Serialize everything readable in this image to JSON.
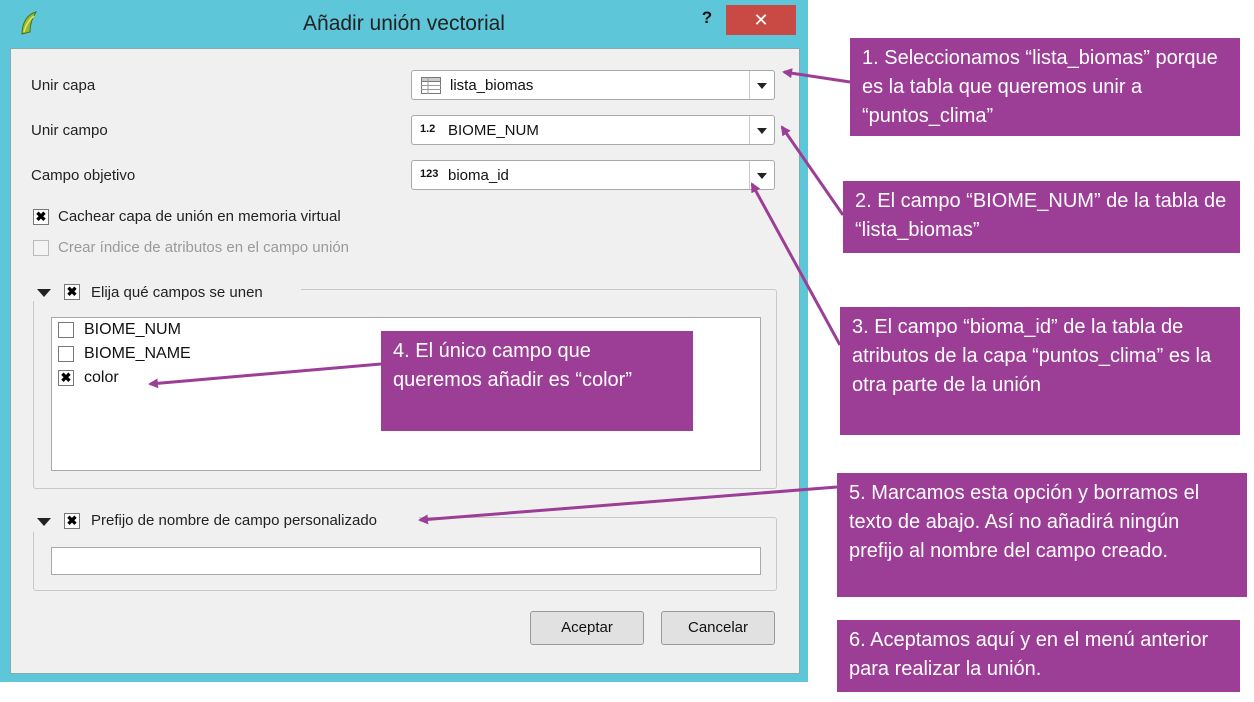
{
  "window": {
    "title": "Añadir unión vectorial",
    "help_label": "?",
    "close_label": "✕"
  },
  "form": {
    "join_layer": {
      "label": "Unir capa",
      "value": "lista_biomas",
      "icon": "table-icon"
    },
    "join_field": {
      "label": "Unir campo",
      "value": "BIOME_NUM",
      "type_badge": "1.2"
    },
    "target_field": {
      "label": "Campo objetivo",
      "value": "bioma_id",
      "type_badge": "123"
    },
    "cache": {
      "label": "Cachear capa de unión en memoria virtual",
      "checked": true,
      "mark": "✖"
    },
    "index": {
      "label": "Crear índice de atributos en el campo unión",
      "checked": false
    },
    "fields_group": {
      "label": "Elija qué campos se unen",
      "checked": true,
      "mark": "✖"
    },
    "fields": [
      {
        "name": "BIOME_NUM",
        "checked": false,
        "mark": ""
      },
      {
        "name": "BIOME_NAME",
        "checked": false,
        "mark": ""
      },
      {
        "name": "color",
        "checked": true,
        "mark": "✖"
      }
    ],
    "prefix_group": {
      "label": "Prefijo de nombre de campo personalizado",
      "checked": true,
      "mark": "✖"
    },
    "prefix_value": ""
  },
  "buttons": {
    "ok": "Aceptar",
    "cancel": "Cancelar"
  },
  "annotations": {
    "n1": "1. Seleccionamos “lista_biomas” porque es la tabla que queremos unir a “puntos_clima”",
    "n2": "2. El campo “BIOME_NUM” de la tabla de “lista_biomas”",
    "n3": "3. El campo “bioma_id” de la tabla de atributos de la capa “puntos_clima” es la otra parte de la unión",
    "n4": "4. El único campo que queremos añadir es “color”",
    "n5": "5. Marcamos esta opción y borramos el texto de abajo. Así no añadirá ningún prefijo al nombre del campo creado.",
    "n6": "6. Aceptamos aquí y en el menú anterior para realizar la unión."
  },
  "colors": {
    "titlebar": "#5ec6d9",
    "close": "#c94a44",
    "annotation": "#9c3d96"
  }
}
